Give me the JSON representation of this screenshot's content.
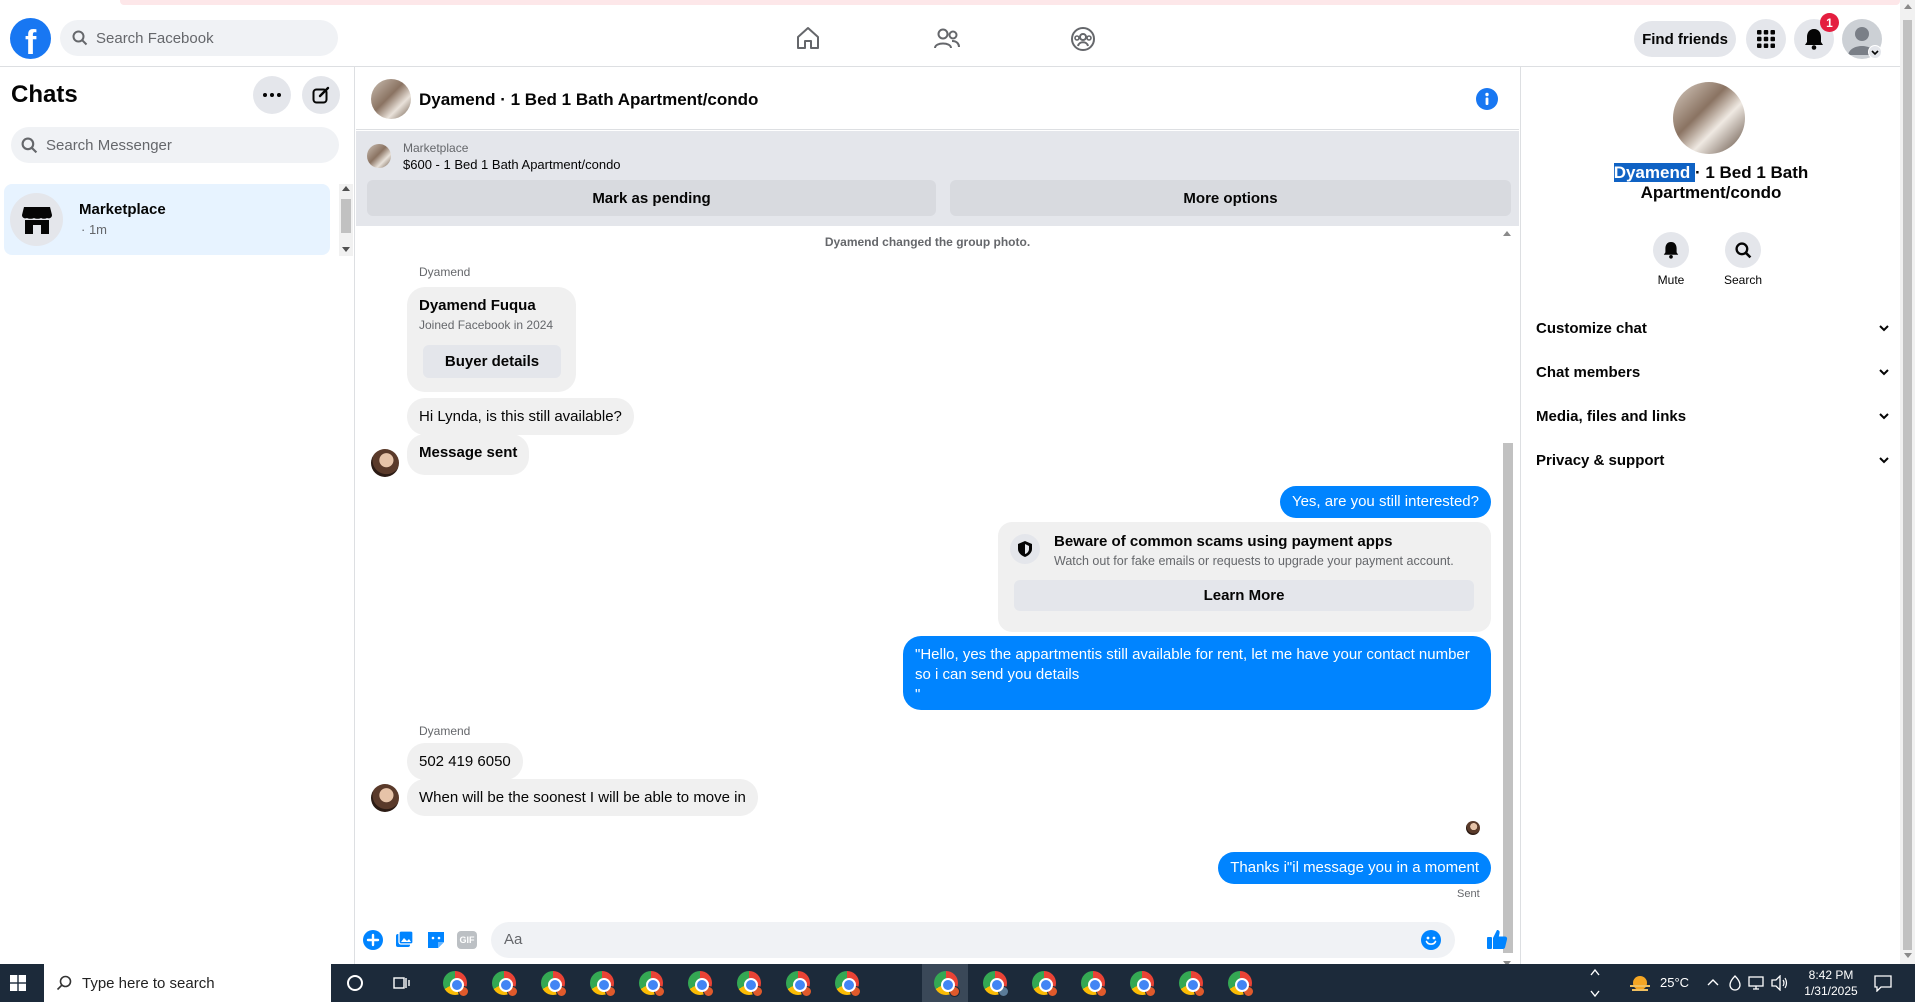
{
  "topbar": {
    "search_placeholder": "Search Facebook",
    "find_friends_label": "Find friends",
    "notification_count": "1"
  },
  "sidebar": {
    "title": "Chats",
    "search_placeholder": "Search Messenger",
    "items": [
      {
        "name": "Marketplace",
        "meta": "· 1m"
      }
    ]
  },
  "chat": {
    "header_title": "Dyamend · 1 Bed 1 Bath Apartment/condo",
    "listing_label": "Marketplace",
    "listing_detail": "$600 - 1 Bed 1 Bath Apartment/condo",
    "mark_pending_label": "Mark as pending",
    "more_options_label": "More options",
    "system_notice": "Dyamend changed the group photo.",
    "profile_card": {
      "sender": "Dyamend",
      "name": "Dyamend Fuqua",
      "joined": "Joined Facebook in 2024",
      "button": "Buyer details"
    },
    "messages": [
      {
        "dir": "in",
        "text": "Hi Lynda, is this still available?"
      },
      {
        "dir": "in",
        "text": "Message sent"
      },
      {
        "dir": "out",
        "text": "Yes, are you still interested?"
      },
      {
        "dir": "out",
        "text": "\"Hello, yes the appartmentis still available for rent, let me have your contact number so i can send you details\n\""
      },
      {
        "dir": "in",
        "sender": "Dyamend",
        "text": "502 419 6050"
      },
      {
        "dir": "in",
        "text": "When will be the soonest I will be able to move in"
      },
      {
        "dir": "out",
        "text": "Thanks i\"il message you in a moment",
        "status": "Sent"
      }
    ],
    "scam_notice": {
      "title": "Beware of common scams using payment apps",
      "body": "Watch out for fake emails or requests to upgrade your payment account.",
      "button": "Learn More"
    },
    "composer_placeholder": "Aa"
  },
  "rpanel": {
    "name_highlight": "Dyamend ",
    "name_rest_1": "· 1 Bed 1 Bath",
    "name_rest_2": "Apartment/condo",
    "mute_label": "Mute",
    "search_label": "Search",
    "sections": [
      "Customize chat",
      "Chat members",
      "Media, files and links",
      "Privacy & support"
    ]
  },
  "taskbar": {
    "search_placeholder": "Type here to search",
    "temperature": "25°C",
    "time": "8:42 PM",
    "date": "1/31/2025"
  },
  "colors": {
    "fb_blue": "#1877f2",
    "messenger_blue": "#0084ff",
    "notif_red": "#e41e3f"
  }
}
